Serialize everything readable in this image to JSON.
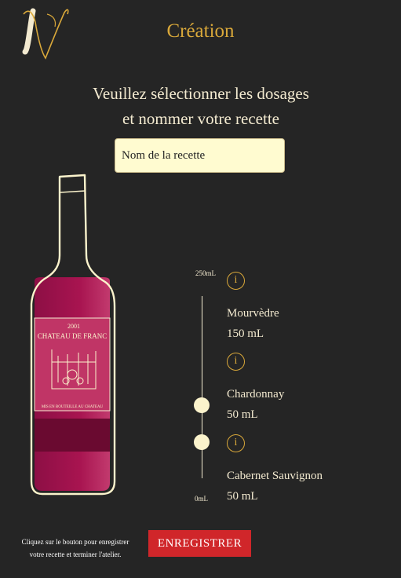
{
  "header": {
    "title": "Création"
  },
  "prompt": {
    "line1": "Veuillez sélectionner les dosages",
    "line2": "et nommer votre recette"
  },
  "recipe_name": {
    "placeholder": "Nom de la recette",
    "value": ""
  },
  "bottle_label": {
    "year": "2001",
    "estate": "CHATEAU DE FRANC",
    "bottom_text": "MIS EN BOUTEILLE AU CHATEAU"
  },
  "dosage": {
    "max_label": "250mL",
    "min_label": "0mL",
    "max_ml": 250,
    "grapes": [
      {
        "name": "Mourvèdre",
        "amount": "150 mL",
        "ml": 150
      },
      {
        "name": "Chardonnay",
        "amount": "50 mL",
        "ml": 50
      },
      {
        "name": "Cabernet Sauvignon",
        "amount": "50 mL",
        "ml": 50
      }
    ]
  },
  "footer": {
    "hint_line1": "Cliquez sur le bouton pour enregistrer",
    "hint_line2": "votre recette et terminer l'atelier.",
    "save_label": "ENREGISTRER"
  },
  "colors": {
    "accent": "#d9a83a",
    "save": "#d0262a",
    "wine": "#a81450",
    "input_bg": "#fffbd0"
  }
}
